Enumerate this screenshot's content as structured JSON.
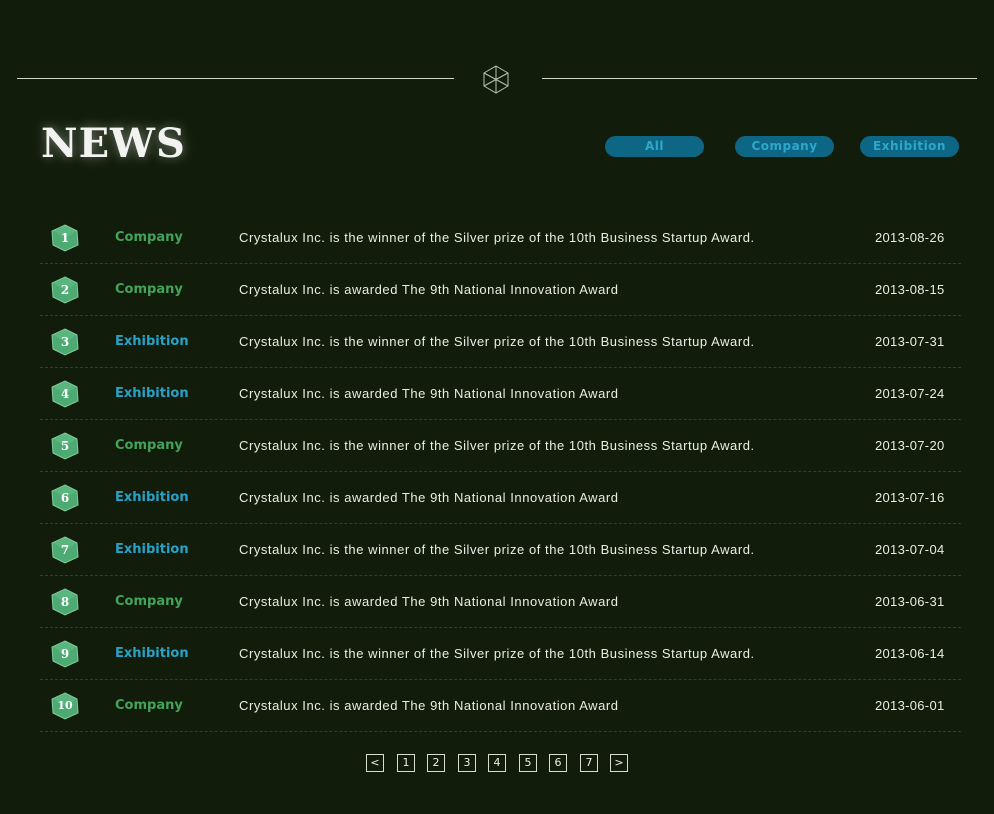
{
  "page_title": "NEWS",
  "filters": [
    {
      "label": "All"
    },
    {
      "label": "Company"
    },
    {
      "label": "Exhibition"
    }
  ],
  "news": [
    {
      "num": "1",
      "category": "Company",
      "title": "Crystalux Inc. is the winner of the Silver prize of the 10th Business Startup Award.",
      "date": "2013-08-26"
    },
    {
      "num": "2",
      "category": "Company",
      "title": "Crystalux Inc. is awarded The 9th National Innovation Award",
      "date": "2013-08-15"
    },
    {
      "num": "3",
      "category": "Exhibition",
      "title": "Crystalux Inc. is the winner of the Silver prize of the 10th Business Startup Award.",
      "date": "2013-07-31"
    },
    {
      "num": "4",
      "category": "Exhibition",
      "title": "Crystalux Inc. is awarded The 9th National Innovation Award",
      "date": "2013-07-24"
    },
    {
      "num": "5",
      "category": "Company",
      "title": "Crystalux Inc. is the winner of the Silver prize of the 10th Business Startup Award.",
      "date": "2013-07-20"
    },
    {
      "num": "6",
      "category": "Exhibition",
      "title": "Crystalux Inc. is awarded The 9th National Innovation Award",
      "date": "2013-07-16"
    },
    {
      "num": "7",
      "category": "Exhibition",
      "title": "Crystalux Inc. is the winner of the Silver prize of the 10th Business Startup Award.",
      "date": "2013-07-04"
    },
    {
      "num": "8",
      "category": "Company",
      "title": "Crystalux Inc. is awarded The 9th National Innovation Award",
      "date": "2013-06-31"
    },
    {
      "num": "9",
      "category": "Exhibition",
      "title": "Crystalux Inc. is the winner of the Silver prize of the 10th Business Startup Award.",
      "date": "2013-06-14"
    },
    {
      "num": "10",
      "category": "Company",
      "title": "Crystalux Inc. is awarded The 9th National Innovation Award",
      "date": "2013-06-01"
    }
  ],
  "pagination": {
    "prev": "<",
    "pages": [
      "1",
      "2",
      "3",
      "4",
      "5",
      "6",
      "7"
    ],
    "next": ">"
  },
  "icons": {
    "divider": "cube-icon",
    "row_badge": "hexagon-badge-icon"
  },
  "colors": {
    "background": "#111d0a",
    "company": "#43a35a",
    "exhibition": "#2aa1c8",
    "filter_bg": "#0d6684",
    "filter_text": "#2fa7cb",
    "badge": "#4daa73"
  }
}
